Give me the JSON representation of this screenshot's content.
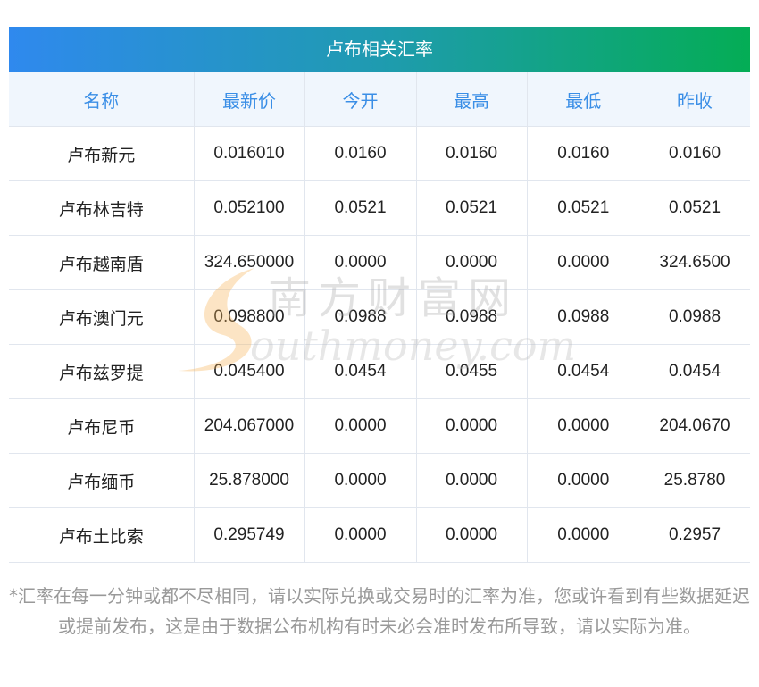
{
  "title": "卢布相关汇率",
  "columns": [
    "名称",
    "最新价",
    "今开",
    "最高",
    "最低",
    "昨收"
  ],
  "rows": [
    [
      "卢布新元",
      "0.016010",
      "0.0160",
      "0.0160",
      "0.0160",
      "0.0160"
    ],
    [
      "卢布林吉特",
      "0.052100",
      "0.0521",
      "0.0521",
      "0.0521",
      "0.0521"
    ],
    [
      "卢布越南盾",
      "324.650000",
      "0.0000",
      "0.0000",
      "0.0000",
      "324.6500"
    ],
    [
      "卢布澳门元",
      "0.098800",
      "0.0988",
      "0.0988",
      "0.0988",
      "0.0988"
    ],
    [
      "卢布兹罗提",
      "0.045400",
      "0.0454",
      "0.0455",
      "0.0454",
      "0.0454"
    ],
    [
      "卢布尼币",
      "204.067000",
      "0.0000",
      "0.0000",
      "0.0000",
      "204.0670"
    ],
    [
      "卢布缅币",
      "25.878000",
      "0.0000",
      "0.0000",
      "0.0000",
      "25.8780"
    ],
    [
      "卢布土比索",
      "0.295749",
      "0.0000",
      "0.0000",
      "0.0000",
      "0.2957"
    ]
  ],
  "watermark": {
    "cn": "南方财富网",
    "en": "southmoney.com"
  },
  "note": "*汇率在每一分钟或都不尽相同，请以实际兑换或交易时的汇率为准，您或许看到有些数据延迟或提前发布，这是由于数据公布机构有时未必会准时发布所导致，请以实际为准。"
}
